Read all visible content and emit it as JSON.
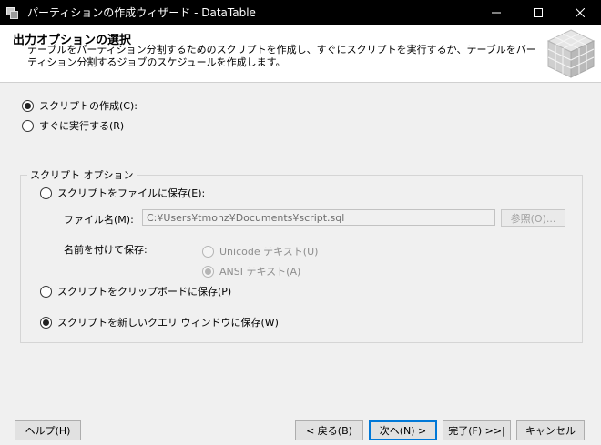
{
  "window": {
    "title": "パーティションの作成ウィザード - DataTable",
    "controls": {
      "minimize": "minimize",
      "maximize": "maximize",
      "close": "close"
    }
  },
  "header": {
    "title": "出力オプションの選択",
    "description": "テーブルをパーティション分割するためのスクリプトを作成し、すぐにスクリプトを実行するか、テーブルをパーティション分割するジョブのスケジュールを作成します。"
  },
  "mode_options": [
    {
      "label": "スクリプトの作成(C):",
      "checked": true
    },
    {
      "label": "すぐに実行する(R)",
      "checked": false
    }
  ],
  "script_options": {
    "group_label": "スクリプト オプション",
    "save_to_file": {
      "label": "スクリプトをファイルに保存(E):",
      "checked": false
    },
    "file_name": {
      "label": "ファイル名(M):",
      "value": "C:¥Users¥tmonz¥Documents¥script.sql",
      "browse_label": "参照(O)..."
    },
    "save_as": {
      "label": "名前を付けて保存:",
      "unicode": {
        "label": "Unicode テキスト(U)",
        "checked": false
      },
      "ansi": {
        "label": "ANSI テキスト(A)",
        "checked": true
      }
    },
    "save_to_clipboard": {
      "label": "スクリプトをクリップボードに保存(P)",
      "checked": false
    },
    "save_to_query_window": {
      "label": "スクリプトを新しいクエリ ウィンドウに保存(W)",
      "checked": true
    }
  },
  "footer": {
    "help": "ヘルプ(H)",
    "back": "< 戻る(B)",
    "next": "次へ(N) >",
    "finish": "完了(F) >>|",
    "cancel": "キャンセル"
  },
  "colors": {
    "titlebar": "#000000",
    "focus_border": "#0078d7",
    "dialog_bg": "#f0f0f0"
  }
}
